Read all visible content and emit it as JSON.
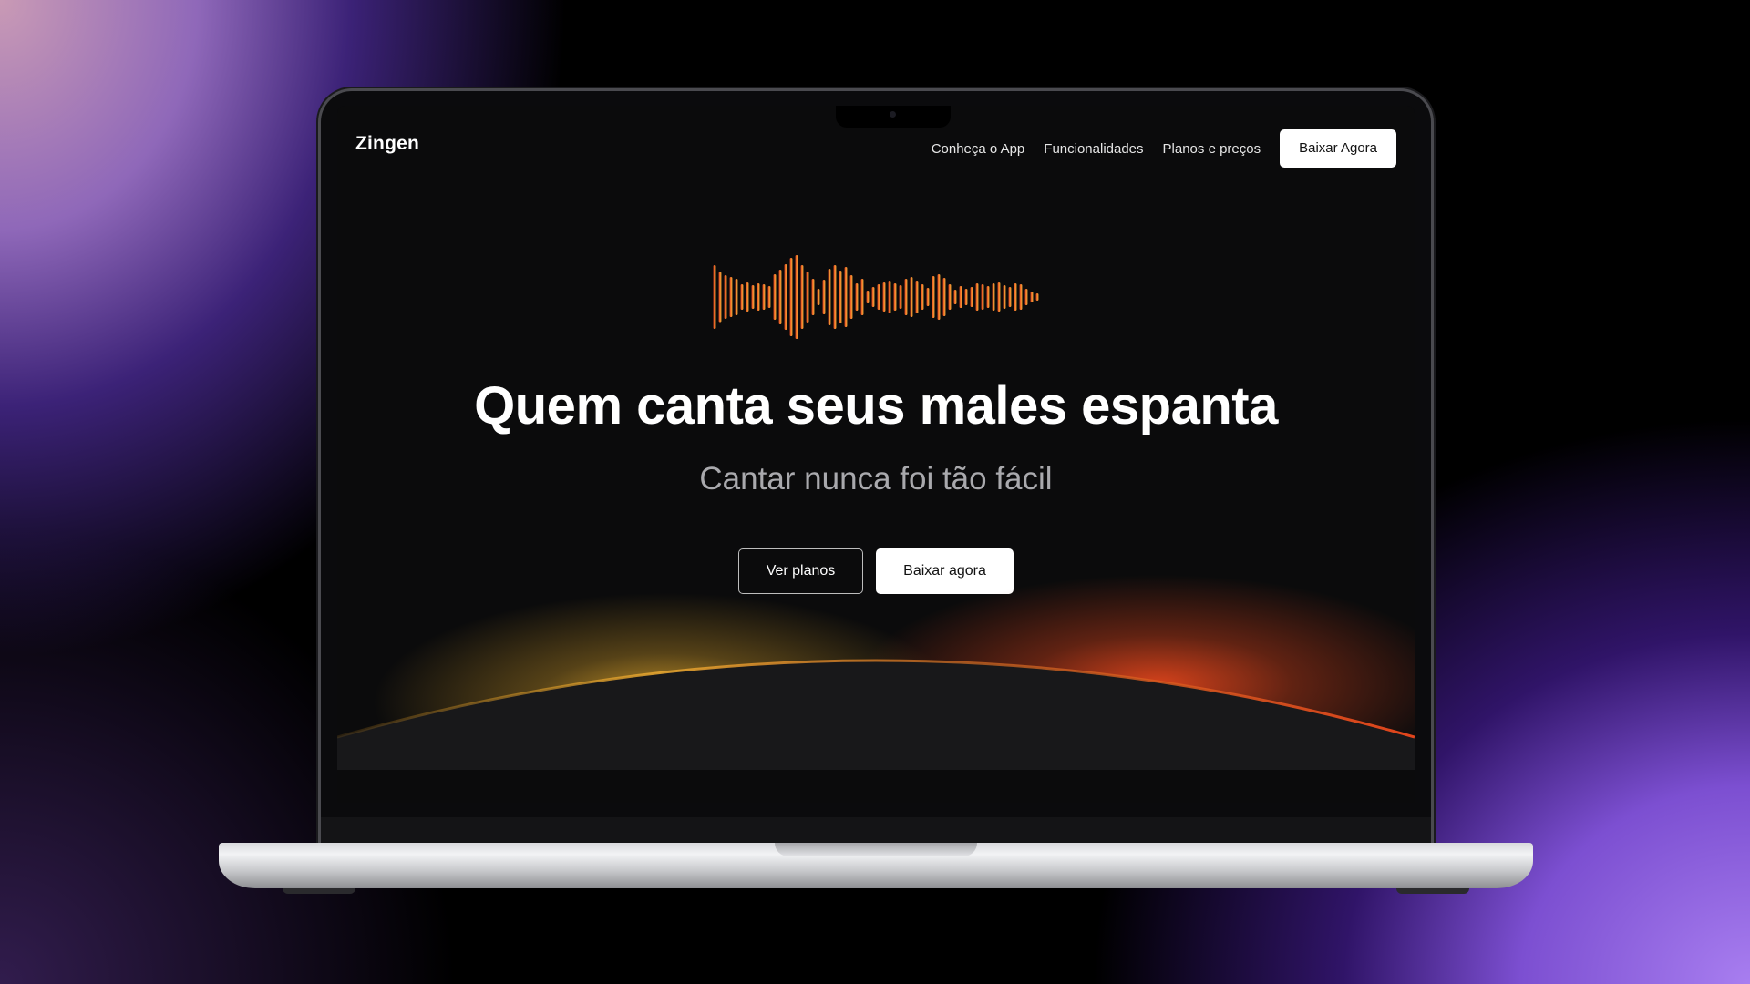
{
  "site": {
    "logo": "Zingen",
    "nav": {
      "links": [
        "Conheça o App",
        "Funcionalidades",
        "Planos e preços"
      ],
      "cta": "Baixar Agora"
    },
    "hero": {
      "headline": "Quem canta seus males espanta",
      "subheadline": "Cantar nunca foi tão fácil",
      "buttons": {
        "secondary": "Ver planos",
        "primary": "Baixar agora"
      }
    }
  },
  "colors": {
    "wave_start": "#e8441f",
    "wave_end": "#f5b33a",
    "glow_left": "#e0a72c",
    "glow_right": "#e0451c",
    "screen_bg": "#0b0b0c",
    "background_accent": "#8f5ae0"
  },
  "icons": [
    "camera-icon",
    "soundwave-icon"
  ]
}
